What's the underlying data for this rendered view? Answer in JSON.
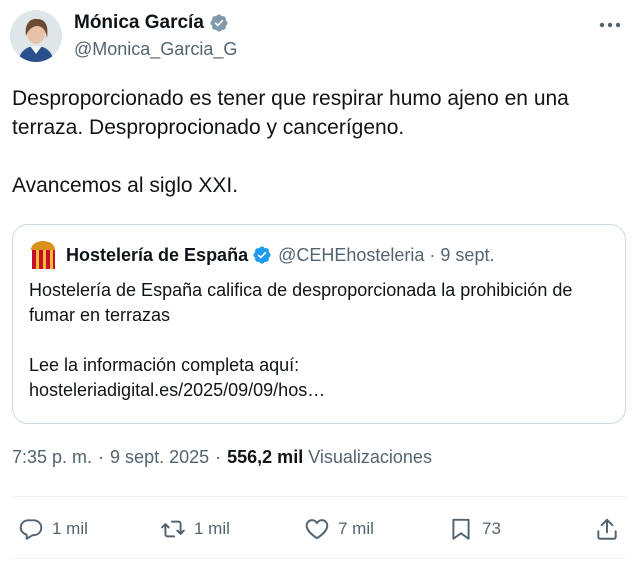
{
  "author": {
    "name": "Mónica García",
    "handle": "@Monica_Garcia_G"
  },
  "tweet": {
    "text": "Desproporcionado es tener que respirar humo ajeno en una terraza. Desproprocionado y cancerígeno.\n\nAvancemos al siglo XXI."
  },
  "quote": {
    "name": "Hostelería de España",
    "handle": "@CEHEhosteleria",
    "separator": "·",
    "date": "9 sept.",
    "text": "Hostelería de España califica de desproporcionada la prohibición de fumar en terrazas\n\nLee la información completa aquí:\nhosteleriadigital.es/2025/09/09/hos…"
  },
  "meta": {
    "time": "7:35 p. m.",
    "separator": "·",
    "date": "9 sept. 2025",
    "views_count": "556,2 mil",
    "views_label": "Visualizaciones"
  },
  "actions": {
    "replies": "1 mil",
    "reposts": "1 mil",
    "likes": "7 mil",
    "bookmarks": "73"
  },
  "colors": {
    "verified": "#1d9bf0",
    "text": "#0f1419",
    "secondary": "#536471",
    "border": "#cfd9de"
  }
}
